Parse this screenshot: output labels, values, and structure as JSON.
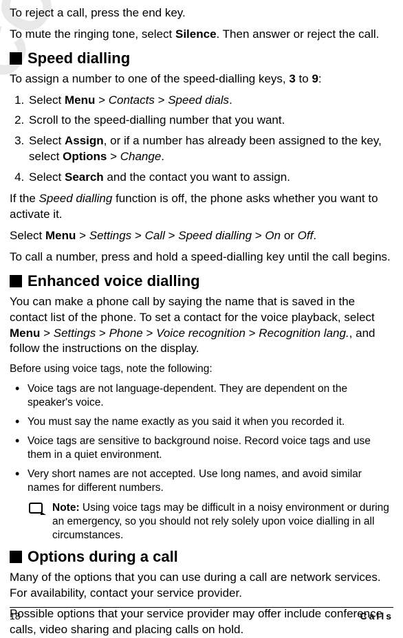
{
  "intro": {
    "p1_a": "To reject a call, press the end key.",
    "p2_a": "To mute the ringing tone, select ",
    "p2_b": "Silence",
    "p2_c": ". Then answer or reject the call."
  },
  "speed": {
    "heading": "Speed dialling",
    "p1_a": "To assign a number to one of the speed-dialling keys, ",
    "p1_b": "3",
    "p1_c": " to ",
    "p1_d": "9",
    "p1_e": ":",
    "steps": {
      "s1_a": "Select ",
      "s1_b": "Menu",
      "s1_c": " > ",
      "s1_d": "Contacts",
      "s1_e": " > ",
      "s1_f": "Speed dials",
      "s1_g": ".",
      "s2": "Scroll to the speed-dialling number that you want.",
      "s3_a": "Select ",
      "s3_b": "Assign",
      "s3_c": ", or if a number has already been assigned to the key, select ",
      "s3_d": "Options",
      "s3_e": " > ",
      "s3_f": "Change",
      "s3_g": ".",
      "s4_a": "Select ",
      "s4_b": "Search",
      "s4_c": " and the contact you want to assign."
    },
    "p2_a": "If the ",
    "p2_b": "Speed dialling",
    "p2_c": " function is off, the phone asks whether you want to activate it.",
    "p3_a": "Select ",
    "p3_b": "Menu",
    "p3_c": " > ",
    "p3_d": "Settings",
    "p3_e": " > ",
    "p3_f": "Call",
    "p3_g": " > ",
    "p3_h": "Speed dialling",
    "p3_i": " > ",
    "p3_j": "On",
    "p3_k": " or ",
    "p3_l": "Off",
    "p3_m": ".",
    "p4": "To call a number, press and hold a speed-dialling key until the call begins."
  },
  "voice": {
    "heading": "Enhanced voice dialling",
    "p1_a": "You can make a phone call by saying the name that is saved in the contact list of the phone. To set a contact for the voice playback, select ",
    "p1_b": "Menu",
    "p1_c": " > ",
    "p1_d": "Settings",
    "p1_e": " > ",
    "p1_f": "Phone",
    "p1_g": " > ",
    "p1_h": "Voice recognition",
    "p1_i": " > ",
    "p1_j": "Recognition lang.",
    "p1_k": ", and follow the instructions on the display.",
    "pre": "Before using voice tags, note the following:",
    "b1": "Voice tags are not language-dependent. They are dependent on the speaker's voice.",
    "b2": "You must say the name exactly as you said it when you recorded it.",
    "b3": "Voice tags are sensitive to background noise. Record voice tags and use them in a quiet environment.",
    "b4": "Very short names are not accepted. Use long names, and avoid similar names for different numbers.",
    "note_a": "Note:",
    "note_b": " Using voice tags may be difficult in a noisy environment or during an emergency, so you should not rely solely upon voice dialling in all circumstances."
  },
  "options": {
    "heading": "Options during a call",
    "p1": "Many of the options that you can use during a call are network services. For availability, contact your service provider.",
    "p2": "Possible options that your service provider may offer include conference calls, video sharing and placing calls on hold."
  },
  "footer": {
    "page": "18",
    "section": "Calls"
  },
  "watermark": "FCC Draft"
}
